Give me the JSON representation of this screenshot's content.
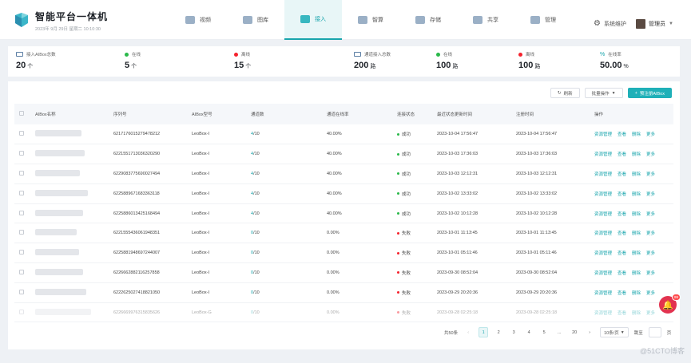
{
  "app": {
    "title": "智能平台一体机",
    "date_line": "2023年 9月 29日  星期二  10:10:30"
  },
  "nav": [
    {
      "label": "视频",
      "icon": "video-icon"
    },
    {
      "label": "图库",
      "icon": "gallery-icon"
    },
    {
      "label": "接入",
      "icon": "access-icon",
      "active": true
    },
    {
      "label": "智算",
      "icon": "compute-icon"
    },
    {
      "label": "存储",
      "icon": "storage-icon"
    },
    {
      "label": "共享",
      "icon": "share-icon"
    },
    {
      "label": "管理",
      "icon": "manage-icon"
    }
  ],
  "header": {
    "system": "系统维护",
    "user": "管理员"
  },
  "stats": [
    {
      "label": "接入AIBox总数",
      "value": "20",
      "unit": "个"
    },
    {
      "label": "在线",
      "value": "5",
      "unit": "个",
      "color": "#2ab94a"
    },
    {
      "label": "离线",
      "value": "15",
      "unit": "个",
      "color": "#f5222d"
    },
    {
      "label": "通道接入总数",
      "value": "200",
      "unit": "路"
    },
    {
      "label": "在线",
      "value": "100",
      "unit": "路",
      "color": "#2ab94a"
    },
    {
      "label": "离线",
      "value": "100",
      "unit": "路",
      "color": "#f5222d"
    },
    {
      "label": "在线率",
      "value": "50.00",
      "unit": "%"
    }
  ],
  "toolbar": {
    "refresh": "刷新",
    "batch": "批量操作",
    "preregister": "预注册AIBox"
  },
  "table": {
    "columns": [
      "AIBox名称",
      "序列号",
      "AIBox型号",
      "通道数",
      "通道在线率",
      "连接状态",
      "最近状态更新时间",
      "注册时间",
      "操作"
    ],
    "ops": [
      "资源管理",
      "查看",
      "删除",
      "更多"
    ],
    "rows": [
      {
        "serial": "6217176015279478212",
        "model": "LeoBox-I",
        "ch": "4",
        "ch_total": "/10",
        "rate": "40.00%",
        "status": "成功",
        "updated": "2023-10-04 17:56:47",
        "registered": "2023-10-04 17:56:47"
      },
      {
        "serial": "6221551713036320290",
        "model": "LeoBox-I",
        "ch": "4",
        "ch_total": "/10",
        "rate": "40.00%",
        "status": "成功",
        "updated": "2023-10-03 17:36:03",
        "registered": "2023-10-03 17:36:03"
      },
      {
        "serial": "6229083775690027494",
        "model": "LeoBox-I",
        "ch": "4",
        "ch_total": "/10",
        "rate": "40.00%",
        "status": "成功",
        "updated": "2023-10-03 12:12:31",
        "registered": "2023-10-03 12:12:31"
      },
      {
        "serial": "6225889671683363118",
        "model": "LeoBox-I",
        "ch": "4",
        "ch_total": "/10",
        "rate": "40.00%",
        "status": "成功",
        "updated": "2023-10-02 13:33:02",
        "registered": "2023-10-02 13:33:02"
      },
      {
        "serial": "6225886013425168494",
        "model": "LeoBox-I",
        "ch": "4",
        "ch_total": "/10",
        "rate": "40.00%",
        "status": "成功",
        "updated": "2023-10-02 10:12:28",
        "registered": "2023-10-02 10:12:28"
      },
      {
        "serial": "6221555436061948351",
        "model": "LeoBox-I",
        "ch": "0",
        "ch_total": "/10",
        "rate": "0.00%",
        "status": "失败",
        "updated": "2023-10-01 11:13:45",
        "registered": "2023-10-01 11:13:45"
      },
      {
        "serial": "6225881948697244007",
        "model": "LeoBox-I",
        "ch": "0",
        "ch_total": "/10",
        "rate": "0.00%",
        "status": "失败",
        "updated": "2023-10-01 05:11:46",
        "registered": "2023-10-01 05:11:46"
      },
      {
        "serial": "6226662882116257858",
        "model": "LeoBox-I",
        "ch": "0",
        "ch_total": "/10",
        "rate": "0.00%",
        "status": "失败",
        "updated": "2023-09-30 08:52:04",
        "registered": "2023-09-30 08:52:04"
      },
      {
        "serial": "6222625027418821050",
        "model": "LeoBox-I",
        "ch": "0",
        "ch_total": "/10",
        "rate": "0.00%",
        "status": "失败",
        "updated": "2023-09-29 20:20:36",
        "registered": "2023-09-29 20:20:36"
      },
      {
        "serial": "6226669976315835626",
        "model": "LeoBox-G",
        "ch": "0",
        "ch_total": "/10",
        "rate": "0.00%",
        "status": "失败",
        "updated": "2023-09-28 02:25:18",
        "registered": "2023-09-28 02:25:18"
      }
    ]
  },
  "pagination": {
    "total": "共50条",
    "pages": [
      "1",
      "2",
      "3",
      "4",
      "5",
      "...",
      "20"
    ],
    "page_size": "10条/页",
    "jump_label": "跳至",
    "page_unit": "页"
  },
  "notification": {
    "count": "99"
  },
  "watermark": "@51CTO博客"
}
